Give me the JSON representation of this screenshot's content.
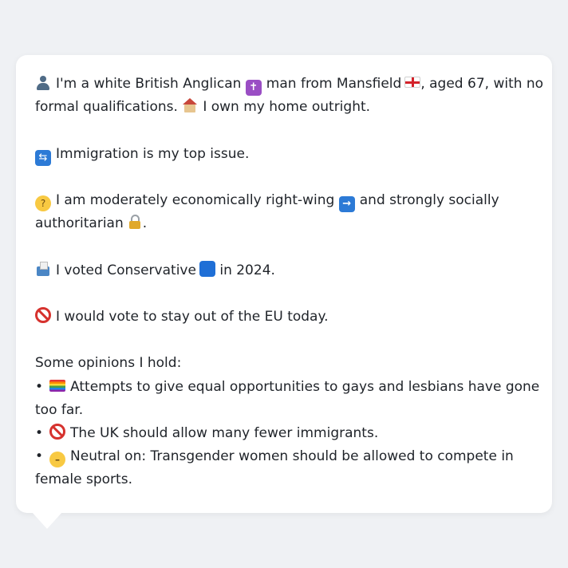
{
  "message": {
    "intro": {
      "icon1": "person-silhouette-icon",
      "text1": "I'm a white British Anglican",
      "icon2": "latin-cross-icon",
      "text2": "man from Mansfield",
      "icon3": "england-flag-icon",
      "text3": ", aged 67, with no",
      "text4": "formal qualifications.",
      "icon4": "house-icon",
      "text5": "I own my home outright."
    },
    "top_issue": {
      "icon": "passport-control-icon",
      "text": "Immigration is my top issue."
    },
    "ideology": {
      "icon1": "thinking-face-icon",
      "text1": "I am moderately economically right-wing",
      "icon2": "right-arrow-icon",
      "text2": "and strongly socially",
      "text3": "authoritarian",
      "icon3": "lock-icon",
      "text4": "."
    },
    "vote": {
      "icon1": "ballot-box-icon",
      "text1": "I voted Conservative",
      "icon2": "blue-square-icon",
      "text2": "in 2024."
    },
    "eu": {
      "icon": "prohibited-icon",
      "text": "I would vote to stay out of the EU today."
    },
    "opinions_heading": "Some opinions I hold:",
    "bullet_char": "•",
    "opinions": [
      {
        "icon": "rainbow-flag-icon",
        "line1": "Attempts to give equal opportunities to gays and lesbians have gone",
        "line2": "too far."
      },
      {
        "icon": "prohibited-icon",
        "line1": "The UK should allow many fewer immigrants."
      },
      {
        "icon": "neutral-face-icon",
        "line1": "Neutral on: Transgender women should be allowed to compete in",
        "line2": "female sports."
      }
    ]
  },
  "colors": {
    "page_background": "#eff1f4",
    "card_background": "#ffffff",
    "text": "#1f2329"
  }
}
